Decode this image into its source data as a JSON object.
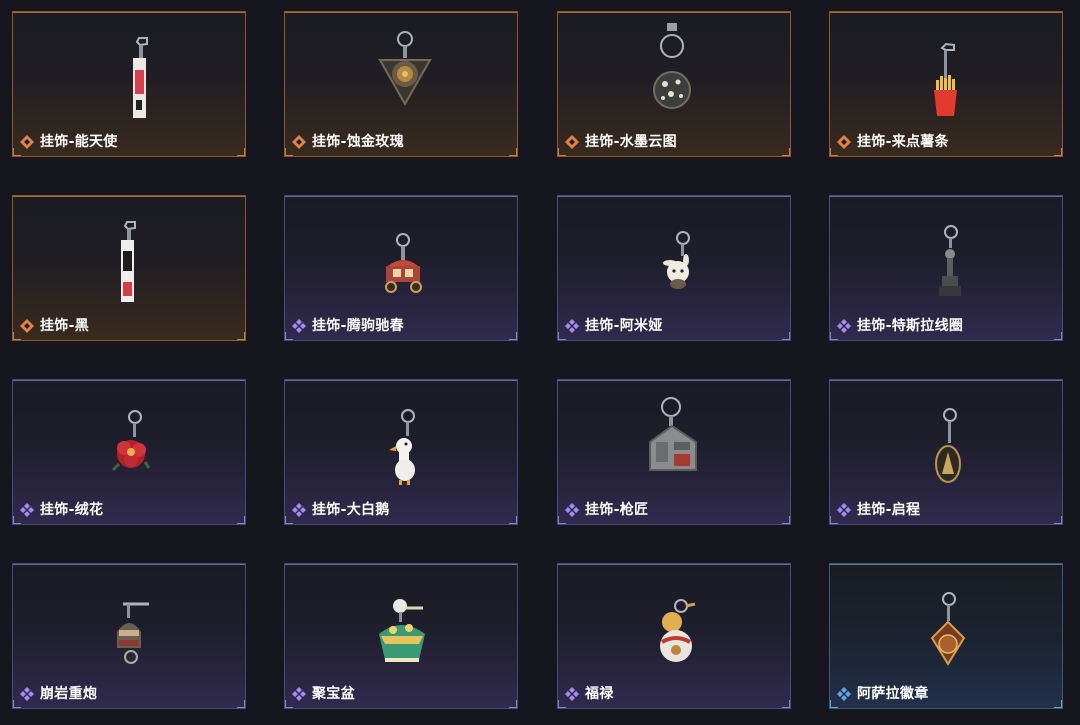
{
  "items": [
    {
      "label": "挂饰-能天使",
      "rarity": "orange",
      "icon": "orange-diamond-icon"
    },
    {
      "label": "挂饰-蚀金玫瑰",
      "rarity": "orange",
      "icon": "orange-diamond-icon"
    },
    {
      "label": "挂饰-水墨云图",
      "rarity": "orange",
      "icon": "orange-diamond-icon"
    },
    {
      "label": "挂饰-来点薯条",
      "rarity": "orange",
      "icon": "orange-diamond-icon"
    },
    {
      "label": "挂饰-黑",
      "rarity": "orange",
      "icon": "orange-diamond-icon"
    },
    {
      "label": "挂饰-腾驹驰春",
      "rarity": "purple",
      "icon": "purple-diamond-icon"
    },
    {
      "label": "挂饰-阿米娅",
      "rarity": "purple",
      "icon": "purple-diamond-icon"
    },
    {
      "label": "挂饰-特斯拉线圈",
      "rarity": "purple",
      "icon": "purple-diamond-icon"
    },
    {
      "label": "挂饰-绒花",
      "rarity": "purple",
      "icon": "purple-diamond-icon"
    },
    {
      "label": "挂饰-大白鹅",
      "rarity": "purple",
      "icon": "purple-diamond-icon"
    },
    {
      "label": "挂饰-枪匠",
      "rarity": "purple",
      "icon": "purple-diamond-icon"
    },
    {
      "label": "挂饰-启程",
      "rarity": "purple",
      "icon": "purple-diamond-icon"
    },
    {
      "label": "崩岩重炮",
      "rarity": "purple",
      "icon": "purple-diamond-icon"
    },
    {
      "label": "聚宝盆",
      "rarity": "purple",
      "icon": "purple-diamond-icon"
    },
    {
      "label": "福禄",
      "rarity": "purple",
      "icon": "purple-diamond-icon"
    },
    {
      "label": "阿萨拉徽章",
      "rarity": "blue",
      "icon": "blue-diamond-icon"
    }
  ],
  "colors": {
    "orange": "#e0834a",
    "purple": "#a58cf0",
    "blue": "#5aa8e8"
  }
}
